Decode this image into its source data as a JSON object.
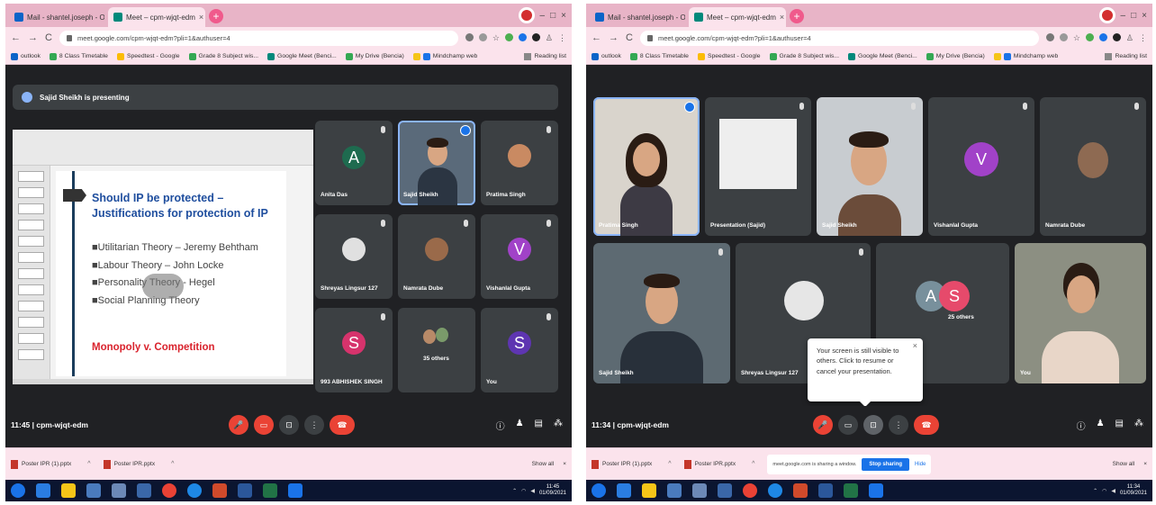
{
  "left": {
    "tabs": [
      {
        "label": "Mail - shantel.joseph - Outlook"
      },
      {
        "label": "Meet – cpm-wjqt-edm"
      }
    ],
    "url": "meet.google.com/cpm-wjqt-edm?pli=1&authuser=4",
    "bookmarks": [
      "outlook",
      "8 Class Timetable",
      "Speedtest - Google",
      "Grade 8 Subject wis...",
      "Google Meet (Benci...",
      "My Drive (Bencia)",
      "Mindchamp web"
    ],
    "reading_list": "Reading list",
    "presenting_banner": "Sajid Sheikh is presenting",
    "slide": {
      "title": "Should IP be protected – Justifications for protection of IP",
      "bullets": [
        "■Utilitarian Theory – Jeremy Behtham",
        "■Labour Theory – John Locke",
        "■Personality Theory - Hegel",
        "■Social Planning Theory"
      ],
      "footer": "Monopoly v. Competition"
    },
    "tiles": [
      {
        "name": "Anita Das",
        "initial": "A"
      },
      {
        "name": "Sajid Sheikh",
        "initial": ""
      },
      {
        "name": "Pratima Singh",
        "initial": ""
      },
      {
        "name": "Shreyas Lingsur 127",
        "initial": ""
      },
      {
        "name": "Namrata Dube",
        "initial": ""
      },
      {
        "name": "Vishanlal Gupta",
        "initial": "V"
      },
      {
        "name": "993 ABHISHEK SINGH",
        "initial": "S"
      },
      {
        "name": "35 others",
        "initial": ""
      },
      {
        "name": "You",
        "initial": "S"
      }
    ],
    "meeting_info": "11:45  |  cpm-wjqt-edm",
    "downloads": [
      "Poster IPR (1).pptx",
      "Poster IPR.pptx"
    ],
    "show_all": "Show all",
    "clock_time": "11:45",
    "clock_date": "01/09/2021"
  },
  "right": {
    "tabs": [
      {
        "label": "Mail - shantel.joseph - Outlook"
      },
      {
        "label": "Meet – cpm-wjqt-edm"
      }
    ],
    "url": "meet.google.com/cpm-wjqt-edm?pli=1&authuser=4",
    "bookmarks": [
      "outlook",
      "8 Class Timetable",
      "Speedtest - Google",
      "Grade 8 Subject wis...",
      "Google Meet (Benci...",
      "My Drive (Bencia)",
      "Mindchamp web"
    ],
    "reading_list": "Reading list",
    "tiles": [
      {
        "name": "Pratima Singh",
        "initial": ""
      },
      {
        "name": "Presentation (Sajid)",
        "initial": ""
      },
      {
        "name": "Sajid Sheikh",
        "initial": ""
      },
      {
        "name": "Vishanlal Gupta",
        "initial": "V"
      },
      {
        "name": "Namrata Dube",
        "initial": ""
      },
      {
        "name": "Sajid Sheikh",
        "initial": ""
      },
      {
        "name": "Shreyas Lingsur 127",
        "initial": ""
      },
      {
        "name": "25 others",
        "initial": ""
      },
      {
        "name": "You",
        "initial": ""
      }
    ],
    "others_initials": [
      "A",
      "S"
    ],
    "tooltip": "Your screen is still visible to others. Click to resume or cancel your presentation.",
    "meeting_info": "11:34  |  cpm-wjqt-edm",
    "downloads": [
      "Poster IPR (1).pptx",
      "Poster IPR.pptx"
    ],
    "sharing_text": "meet.google.com is sharing a window.",
    "stop_sharing": "Stop sharing",
    "hide": "Hide",
    "show_all": "Show all",
    "clock_time": "11:34",
    "clock_date": "01/09/2021"
  },
  "colors": {
    "meet_bg": "#202124",
    "tile_bg": "#3c4043",
    "end_red": "#ea4335",
    "chrome_pink": "#fbe3ec",
    "accent_blue": "#1a73e8"
  }
}
